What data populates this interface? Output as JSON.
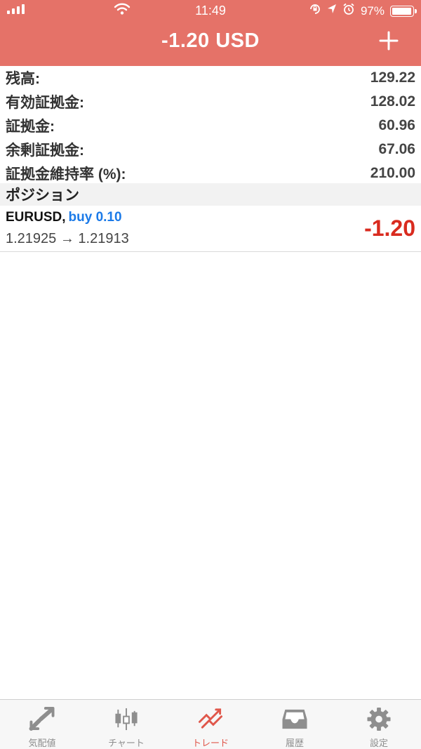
{
  "status_bar": {
    "time": "11:49",
    "battery_percent": "97%",
    "battery_level": 0.97,
    "signal_bars": 4,
    "icons": [
      "signal-icon",
      "wifi-icon",
      "orientation-lock-icon",
      "location-icon",
      "alarm-icon",
      "battery-icon"
    ]
  },
  "header": {
    "title": "-1.20 USD",
    "add_button_icon": "plus-icon",
    "background_color": "#e57268"
  },
  "summary": [
    {
      "label": "残高:",
      "value": "129.22"
    },
    {
      "label": "有効証拠金:",
      "value": "128.02"
    },
    {
      "label": "証拠金:",
      "value": "60.96"
    },
    {
      "label": "余剰証拠金:",
      "value": "67.06"
    },
    {
      "label": "証拠金維持率 (%):",
      "value": "210.00"
    }
  ],
  "positions_section": {
    "title": "ポジション",
    "items": [
      {
        "symbol": "EURUSD,",
        "side": "buy 0.10",
        "prices": "1.21925 → 1.21913",
        "profit": "-1.20"
      }
    ]
  },
  "colors": {
    "accent": "#e57268",
    "buy_blue": "#1b7ae8",
    "loss_red": "#d92b1f",
    "tab_active": "#e0574b",
    "tab_inactive": "#8e8e8e"
  },
  "tabbar": {
    "tabs": [
      {
        "label": "気配値",
        "icon": "quotes-arrows-icon",
        "active": false
      },
      {
        "label": "チャート",
        "icon": "candlestick-chart-icon",
        "active": false
      },
      {
        "label": "トレード",
        "icon": "trade-icon",
        "active": true
      },
      {
        "label": "履歴",
        "icon": "history-tray-icon",
        "active": false
      },
      {
        "label": "設定",
        "icon": "settings-gear-icon",
        "active": false
      }
    ]
  }
}
